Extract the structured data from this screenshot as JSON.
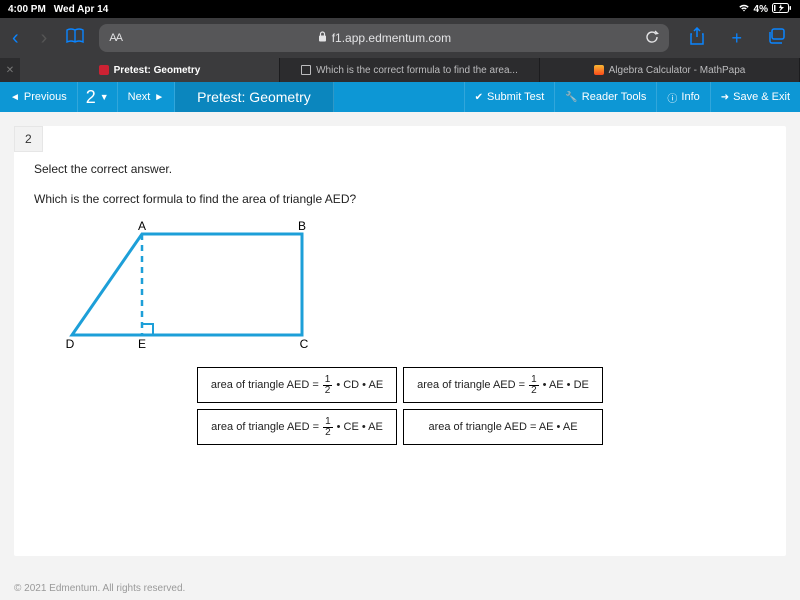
{
  "statusbar": {
    "time": "4:00 PM",
    "date": "Wed Apr 14",
    "battery": "4%"
  },
  "browser": {
    "aa": "AA",
    "url": "f1.app.edmentum.com"
  },
  "tabs": {
    "t1": "Pretest: Geometry",
    "t2": "Which is the correct formula to find the area...",
    "t3": "Algebra Calculator - MathPapa"
  },
  "toolbar": {
    "previous": "Previous",
    "qnum": "2",
    "next": "Next",
    "title": "Pretest: Geometry",
    "submit": "Submit Test",
    "reader": "Reader Tools",
    "info": "Info",
    "save": "Save & Exit"
  },
  "question": {
    "number": "2",
    "instruction": "Select the correct answer.",
    "prompt": "Which is the correct formula to find the area of triangle AED?"
  },
  "figure": {
    "A": "A",
    "B": "B",
    "C": "C",
    "D": "D",
    "E": "E"
  },
  "answers": {
    "a1_pre": "area of triangle AED =",
    "a1_post": "• CD • AE",
    "a2_pre": "area of triangle AED =",
    "a2_post": "• AE • DE",
    "a3_pre": "area of triangle AED =",
    "a3_post": "• CE • AE",
    "a4_pre": "area of triangle AED = AE • AE"
  },
  "frac": {
    "num": "1",
    "den": "2"
  },
  "footer": "© 2021 Edmentum. All rights reserved."
}
